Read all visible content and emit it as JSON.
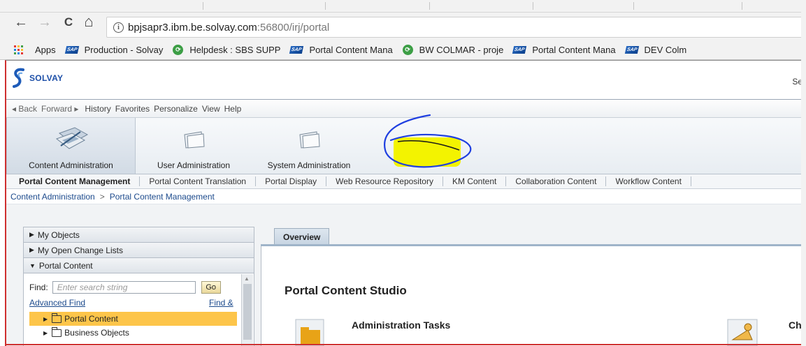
{
  "browser": {
    "url_host": "bpjsapr3.ibm.be.solvay.com",
    "url_path": ":56800/irj/portal",
    "nav": {
      "back": "←",
      "forward": "→",
      "reload": "C",
      "home": "⌂"
    },
    "bookmarks": [
      {
        "label": "Apps",
        "icon": "apps-grid-icon"
      },
      {
        "label": "Production - Solvay",
        "icon": "sap-icon"
      },
      {
        "label": "Helpdesk : SBS SUPP",
        "icon": "green-circle-icon"
      },
      {
        "label": "Portal Content Mana",
        "icon": "sap-icon"
      },
      {
        "label": "BW COLMAR - proje",
        "icon": "green-circle-icon"
      },
      {
        "label": "Portal Content Mana",
        "icon": "sap-icon"
      },
      {
        "label": "DEV Colm",
        "icon": "sap-icon"
      }
    ]
  },
  "portal": {
    "logo_text": "SOLVAY",
    "header_right": "Se",
    "menu": {
      "back": "◂ Back",
      "forward": "Forward ▸",
      "items": [
        "History",
        "Favorites",
        "Personalize",
        "View",
        "Help"
      ]
    },
    "launchpad": [
      {
        "label": "Content Administration",
        "icon": "content-admin-icon",
        "active": true
      },
      {
        "label": "User Administration",
        "icon": "folder-icon",
        "active": false
      },
      {
        "label": "System Administration",
        "icon": "folder-icon",
        "active": false
      }
    ],
    "subnav": [
      "Portal Content Management",
      "Portal Content Translation",
      "Portal Display",
      "Web Resource Repository",
      "KM Content",
      "Collaboration Content",
      "Workflow Content"
    ],
    "breadcrumb": [
      "Content Administration",
      ">",
      "Portal Content Management"
    ],
    "left_panel": {
      "sections": [
        {
          "label": "My Objects",
          "expanded": false
        },
        {
          "label": "My Open Change Lists",
          "expanded": false
        },
        {
          "label": "Portal Content",
          "expanded": true
        }
      ],
      "find_label": "Find:",
      "find_placeholder": "Enter search string",
      "go": "Go",
      "advanced_find": "Advanced Find",
      "find_and": "Find &",
      "tree": [
        "Portal Content",
        "Business Objects"
      ]
    },
    "main": {
      "tab": "Overview",
      "title": "Portal Content Studio",
      "section1": "Administration Tasks",
      "section2": "Ch"
    }
  },
  "colors": {
    "highlight": "#fdc54a",
    "annotation_yellow": "#f3f300",
    "annotation_blue": "#1f3fe0",
    "frame_red": "#cf2f2f"
  }
}
